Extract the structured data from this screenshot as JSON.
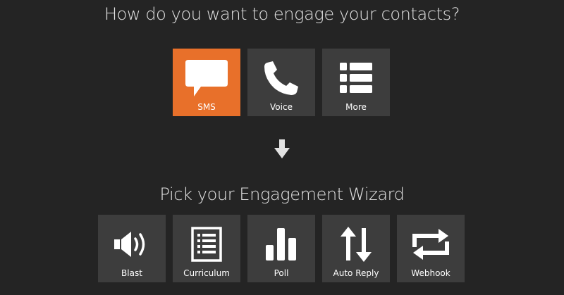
{
  "headings": {
    "channel_question": "How do you want to engage your contacts?",
    "wizard_prompt": "Pick your Engagement Wizard"
  },
  "channels": [
    {
      "label": "SMS",
      "icon": "speech-bubble-icon",
      "selected": true
    },
    {
      "label": "Voice",
      "icon": "phone-icon",
      "selected": false
    },
    {
      "label": "More",
      "icon": "list-icon",
      "selected": false
    }
  ],
  "wizards": [
    {
      "label": "Blast",
      "icon": "speaker-icon"
    },
    {
      "label": "Curriculum",
      "icon": "document-list-icon"
    },
    {
      "label": "Poll",
      "icon": "bar-chart-icon"
    },
    {
      "label": "Auto Reply",
      "icon": "up-down-arrows-icon"
    },
    {
      "label": "Webhook",
      "icon": "repeat-icon"
    }
  ],
  "colors": {
    "background": "#242424",
    "tile": "#3d3d3d",
    "accent": "#e8702a",
    "text": "#ffffff"
  }
}
